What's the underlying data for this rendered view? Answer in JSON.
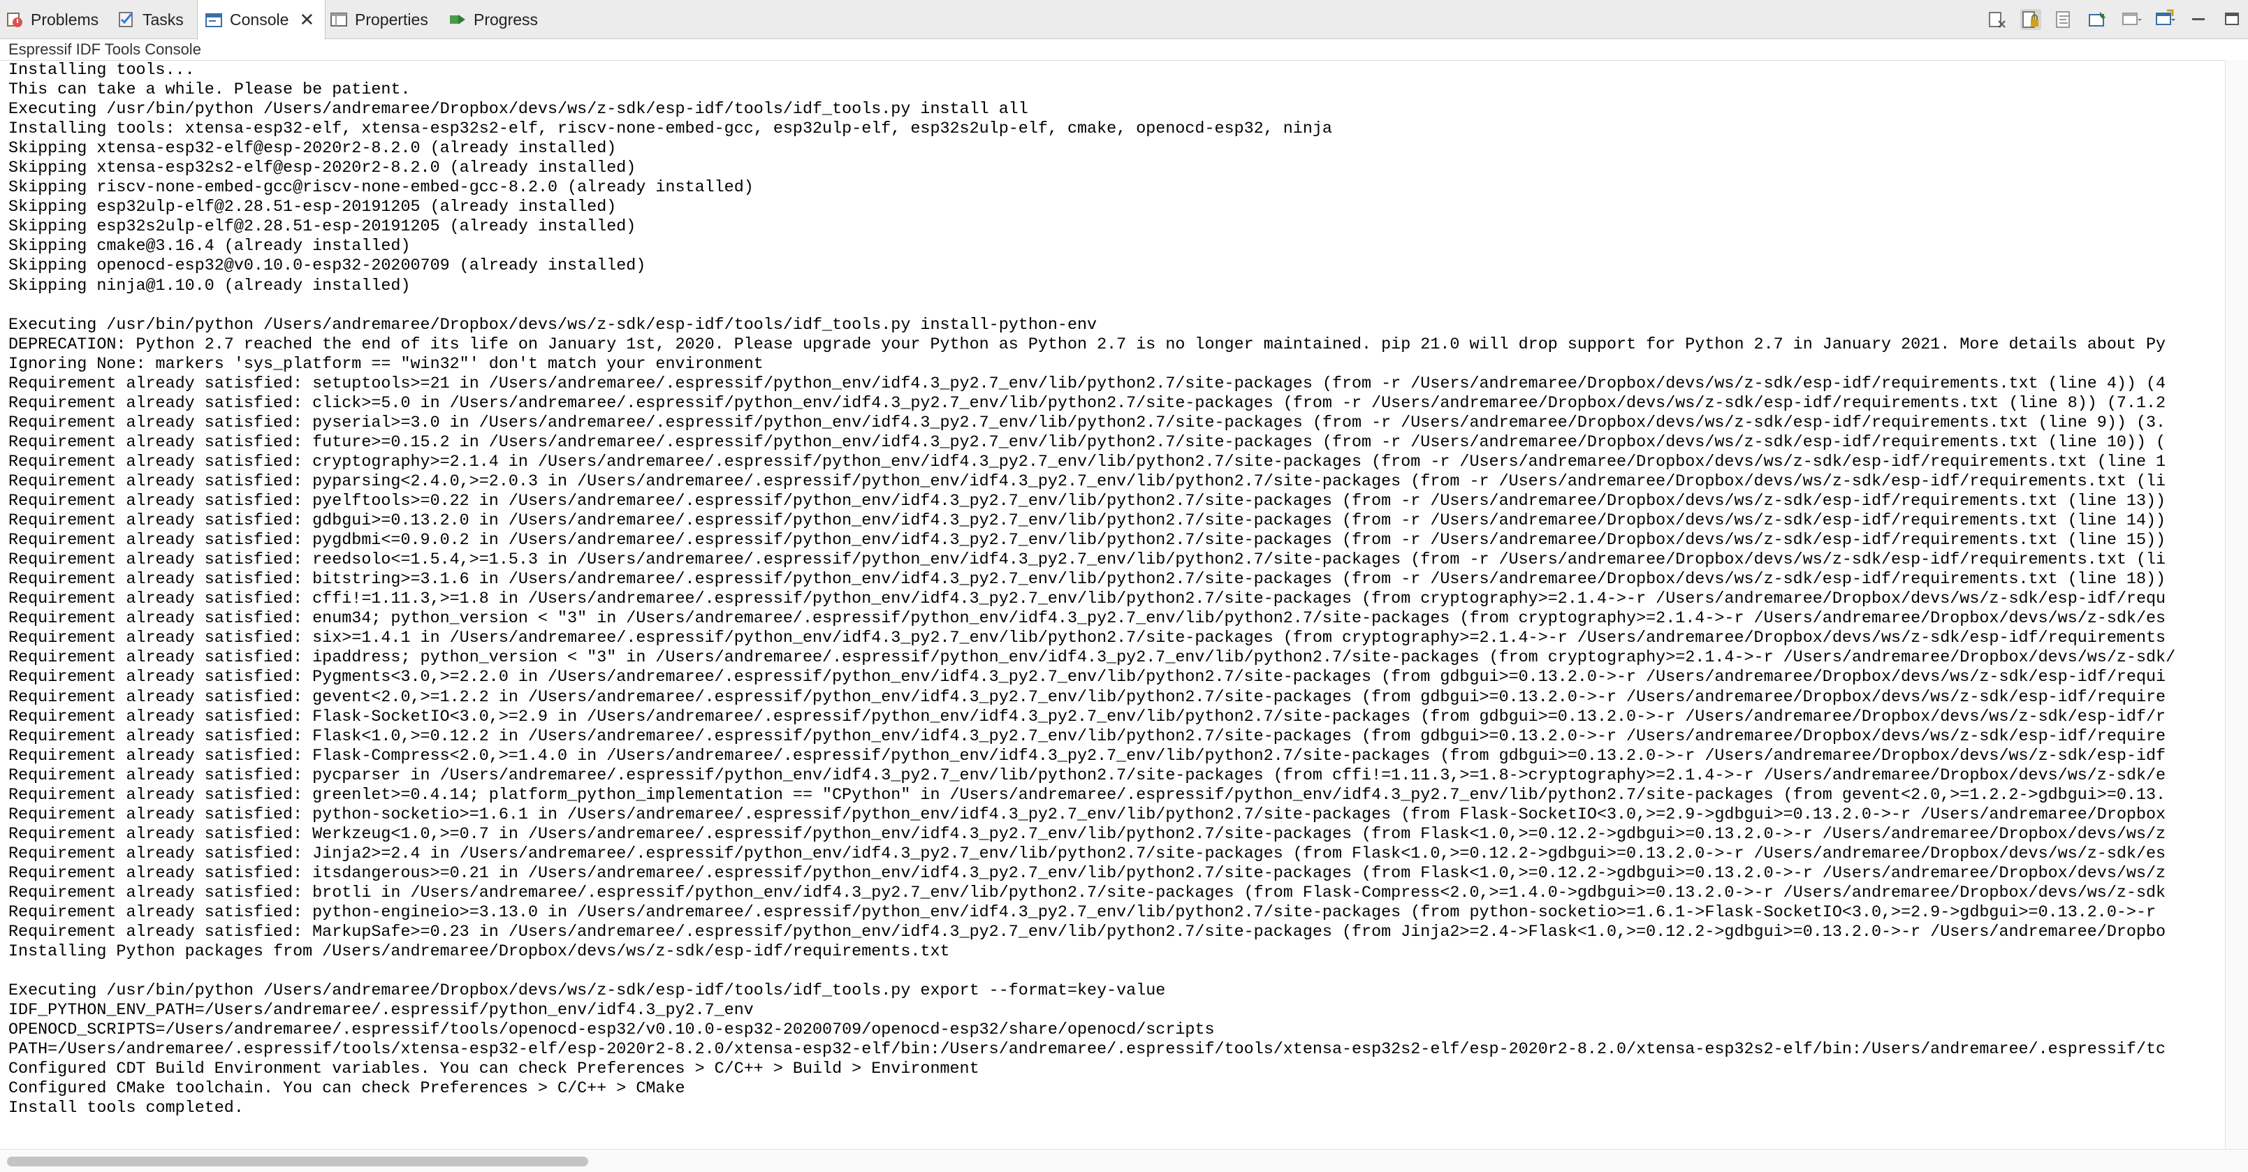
{
  "tabs": [
    {
      "label": "Problems",
      "icon": "problems-icon"
    },
    {
      "label": "Tasks",
      "icon": "tasks-icon"
    },
    {
      "label": "Console",
      "icon": "console-icon",
      "active": true
    },
    {
      "label": "Properties",
      "icon": "properties-icon"
    },
    {
      "label": "Progress",
      "icon": "progress-icon"
    }
  ],
  "toolbar": {
    "icons": [
      "remove-launch-icon",
      "scroll-lock-icon",
      "word-wrap-icon",
      "pin-console-icon",
      "display-selected-console-icon",
      "open-console-icon",
      "minimize-icon",
      "maximize-icon"
    ]
  },
  "console": {
    "title": "Espressif IDF Tools Console",
    "lines": [
      "Installing tools...",
      "This can take a while. Please be patient.",
      "Executing /usr/bin/python /Users/andremaree/Dropbox/devs/ws/z-sdk/esp-idf/tools/idf_tools.py install all",
      "Installing tools: xtensa-esp32-elf, xtensa-esp32s2-elf, riscv-none-embed-gcc, esp32ulp-elf, esp32s2ulp-elf, cmake, openocd-esp32, ninja",
      "Skipping xtensa-esp32-elf@esp-2020r2-8.2.0 (already installed)",
      "Skipping xtensa-esp32s2-elf@esp-2020r2-8.2.0 (already installed)",
      "Skipping riscv-none-embed-gcc@riscv-none-embed-gcc-8.2.0 (already installed)",
      "Skipping esp32ulp-elf@2.28.51-esp-20191205 (already installed)",
      "Skipping esp32s2ulp-elf@2.28.51-esp-20191205 (already installed)",
      "Skipping cmake@3.16.4 (already installed)",
      "Skipping openocd-esp32@v0.10.0-esp32-20200709 (already installed)",
      "Skipping ninja@1.10.0 (already installed)",
      "",
      "Executing /usr/bin/python /Users/andremaree/Dropbox/devs/ws/z-sdk/esp-idf/tools/idf_tools.py install-python-env",
      "DEPRECATION: Python 2.7 reached the end of its life on January 1st, 2020. Please upgrade your Python as Python 2.7 is no longer maintained. pip 21.0 will drop support for Python 2.7 in January 2021. More details about Py",
      "Ignoring None: markers 'sys_platform == \"win32\"' don't match your environment",
      "Requirement already satisfied: setuptools>=21 in /Users/andremaree/.espressif/python_env/idf4.3_py2.7_env/lib/python2.7/site-packages (from -r /Users/andremaree/Dropbox/devs/ws/z-sdk/esp-idf/requirements.txt (line 4)) (4",
      "Requirement already satisfied: click>=5.0 in /Users/andremaree/.espressif/python_env/idf4.3_py2.7_env/lib/python2.7/site-packages (from -r /Users/andremaree/Dropbox/devs/ws/z-sdk/esp-idf/requirements.txt (line 8)) (7.1.2",
      "Requirement already satisfied: pyserial>=3.0 in /Users/andremaree/.espressif/python_env/idf4.3_py2.7_env/lib/python2.7/site-packages (from -r /Users/andremaree/Dropbox/devs/ws/z-sdk/esp-idf/requirements.txt (line 9)) (3.",
      "Requirement already satisfied: future>=0.15.2 in /Users/andremaree/.espressif/python_env/idf4.3_py2.7_env/lib/python2.7/site-packages (from -r /Users/andremaree/Dropbox/devs/ws/z-sdk/esp-idf/requirements.txt (line 10)) (",
      "Requirement already satisfied: cryptography>=2.1.4 in /Users/andremaree/.espressif/python_env/idf4.3_py2.7_env/lib/python2.7/site-packages (from -r /Users/andremaree/Dropbox/devs/ws/z-sdk/esp-idf/requirements.txt (line 1",
      "Requirement already satisfied: pyparsing<2.4.0,>=2.0.3 in /Users/andremaree/.espressif/python_env/idf4.3_py2.7_env/lib/python2.7/site-packages (from -r /Users/andremaree/Dropbox/devs/ws/z-sdk/esp-idf/requirements.txt (li",
      "Requirement already satisfied: pyelftools>=0.22 in /Users/andremaree/.espressif/python_env/idf4.3_py2.7_env/lib/python2.7/site-packages (from -r /Users/andremaree/Dropbox/devs/ws/z-sdk/esp-idf/requirements.txt (line 13))",
      "Requirement already satisfied: gdbgui>=0.13.2.0 in /Users/andremaree/.espressif/python_env/idf4.3_py2.7_env/lib/python2.7/site-packages (from -r /Users/andremaree/Dropbox/devs/ws/z-sdk/esp-idf/requirements.txt (line 14))",
      "Requirement already satisfied: pygdbmi<=0.9.0.2 in /Users/andremaree/.espressif/python_env/idf4.3_py2.7_env/lib/python2.7/site-packages (from -r /Users/andremaree/Dropbox/devs/ws/z-sdk/esp-idf/requirements.txt (line 15))",
      "Requirement already satisfied: reedsolo<=1.5.4,>=1.5.3 in /Users/andremaree/.espressif/python_env/idf4.3_py2.7_env/lib/python2.7/site-packages (from -r /Users/andremaree/Dropbox/devs/ws/z-sdk/esp-idf/requirements.txt (li",
      "Requirement already satisfied: bitstring>=3.1.6 in /Users/andremaree/.espressif/python_env/idf4.3_py2.7_env/lib/python2.7/site-packages (from -r /Users/andremaree/Dropbox/devs/ws/z-sdk/esp-idf/requirements.txt (line 18))",
      "Requirement already satisfied: cffi!=1.11.3,>=1.8 in /Users/andremaree/.espressif/python_env/idf4.3_py2.7_env/lib/python2.7/site-packages (from cryptography>=2.1.4->-r /Users/andremaree/Dropbox/devs/ws/z-sdk/esp-idf/requ",
      "Requirement already satisfied: enum34; python_version < \"3\" in /Users/andremaree/.espressif/python_env/idf4.3_py2.7_env/lib/python2.7/site-packages (from cryptography>=2.1.4->-r /Users/andremaree/Dropbox/devs/ws/z-sdk/es",
      "Requirement already satisfied: six>=1.4.1 in /Users/andremaree/.espressif/python_env/idf4.3_py2.7_env/lib/python2.7/site-packages (from cryptography>=2.1.4->-r /Users/andremaree/Dropbox/devs/ws/z-sdk/esp-idf/requirements",
      "Requirement already satisfied: ipaddress; python_version < \"3\" in /Users/andremaree/.espressif/python_env/idf4.3_py2.7_env/lib/python2.7/site-packages (from cryptography>=2.1.4->-r /Users/andremaree/Dropbox/devs/ws/z-sdk/",
      "Requirement already satisfied: Pygments<3.0,>=2.2.0 in /Users/andremaree/.espressif/python_env/idf4.3_py2.7_env/lib/python2.7/site-packages (from gdbgui>=0.13.2.0->-r /Users/andremaree/Dropbox/devs/ws/z-sdk/esp-idf/requi",
      "Requirement already satisfied: gevent<2.0,>=1.2.2 in /Users/andremaree/.espressif/python_env/idf4.3_py2.7_env/lib/python2.7/site-packages (from gdbgui>=0.13.2.0->-r /Users/andremaree/Dropbox/devs/ws/z-sdk/esp-idf/require",
      "Requirement already satisfied: Flask-SocketIO<3.0,>=2.9 in /Users/andremaree/.espressif/python_env/idf4.3_py2.7_env/lib/python2.7/site-packages (from gdbgui>=0.13.2.0->-r /Users/andremaree/Dropbox/devs/ws/z-sdk/esp-idf/r",
      "Requirement already satisfied: Flask<1.0,>=0.12.2 in /Users/andremaree/.espressif/python_env/idf4.3_py2.7_env/lib/python2.7/site-packages (from gdbgui>=0.13.2.0->-r /Users/andremaree/Dropbox/devs/ws/z-sdk/esp-idf/require",
      "Requirement already satisfied: Flask-Compress<2.0,>=1.4.0 in /Users/andremaree/.espressif/python_env/idf4.3_py2.7_env/lib/python2.7/site-packages (from gdbgui>=0.13.2.0->-r /Users/andremaree/Dropbox/devs/ws/z-sdk/esp-idf",
      "Requirement already satisfied: pycparser in /Users/andremaree/.espressif/python_env/idf4.3_py2.7_env/lib/python2.7/site-packages (from cffi!=1.11.3,>=1.8->cryptography>=2.1.4->-r /Users/andremaree/Dropbox/devs/ws/z-sdk/e",
      "Requirement already satisfied: greenlet>=0.4.14; platform_python_implementation == \"CPython\" in /Users/andremaree/.espressif/python_env/idf4.3_py2.7_env/lib/python2.7/site-packages (from gevent<2.0,>=1.2.2->gdbgui>=0.13.",
      "Requirement already satisfied: python-socketio>=1.6.1 in /Users/andremaree/.espressif/python_env/idf4.3_py2.7_env/lib/python2.7/site-packages (from Flask-SocketIO<3.0,>=2.9->gdbgui>=0.13.2.0->-r /Users/andremaree/Dropbox",
      "Requirement already satisfied: Werkzeug<1.0,>=0.7 in /Users/andremaree/.espressif/python_env/idf4.3_py2.7_env/lib/python2.7/site-packages (from Flask<1.0,>=0.12.2->gdbgui>=0.13.2.0->-r /Users/andremaree/Dropbox/devs/ws/z",
      "Requirement already satisfied: Jinja2>=2.4 in /Users/andremaree/.espressif/python_env/idf4.3_py2.7_env/lib/python2.7/site-packages (from Flask<1.0,>=0.12.2->gdbgui>=0.13.2.0->-r /Users/andremaree/Dropbox/devs/ws/z-sdk/es",
      "Requirement already satisfied: itsdangerous>=0.21 in /Users/andremaree/.espressif/python_env/idf4.3_py2.7_env/lib/python2.7/site-packages (from Flask<1.0,>=0.12.2->gdbgui>=0.13.2.0->-r /Users/andremaree/Dropbox/devs/ws/z",
      "Requirement already satisfied: brotli in /Users/andremaree/.espressif/python_env/idf4.3_py2.7_env/lib/python2.7/site-packages (from Flask-Compress<2.0,>=1.4.0->gdbgui>=0.13.2.0->-r /Users/andremaree/Dropbox/devs/ws/z-sdk",
      "Requirement already satisfied: python-engineio>=3.13.0 in /Users/andremaree/.espressif/python_env/idf4.3_py2.7_env/lib/python2.7/site-packages (from python-socketio>=1.6.1->Flask-SocketIO<3.0,>=2.9->gdbgui>=0.13.2.0->-r",
      "Requirement already satisfied: MarkupSafe>=0.23 in /Users/andremaree/.espressif/python_env/idf4.3_py2.7_env/lib/python2.7/site-packages (from Jinja2>=2.4->Flask<1.0,>=0.12.2->gdbgui>=0.13.2.0->-r /Users/andremaree/Dropbo",
      "Installing Python packages from /Users/andremaree/Dropbox/devs/ws/z-sdk/esp-idf/requirements.txt",
      "",
      "Executing /usr/bin/python /Users/andremaree/Dropbox/devs/ws/z-sdk/esp-idf/tools/idf_tools.py export --format=key-value",
      "IDF_PYTHON_ENV_PATH=/Users/andremaree/.espressif/python_env/idf4.3_py2.7_env",
      "OPENOCD_SCRIPTS=/Users/andremaree/.espressif/tools/openocd-esp32/v0.10.0-esp32-20200709/openocd-esp32/share/openocd/scripts",
      "PATH=/Users/andremaree/.espressif/tools/xtensa-esp32-elf/esp-2020r2-8.2.0/xtensa-esp32-elf/bin:/Users/andremaree/.espressif/tools/xtensa-esp32s2-elf/esp-2020r2-8.2.0/xtensa-esp32s2-elf/bin:/Users/andremaree/.espressif/tc",
      "Configured CDT Build Environment variables. You can check Preferences > C/C++ > Build > Environment",
      "Configured CMake toolchain. You can check Preferences > C/C++ > CMake",
      "Install tools completed."
    ]
  },
  "scrollbar": {
    "horizontal_thumb_fraction": 0.26
  }
}
